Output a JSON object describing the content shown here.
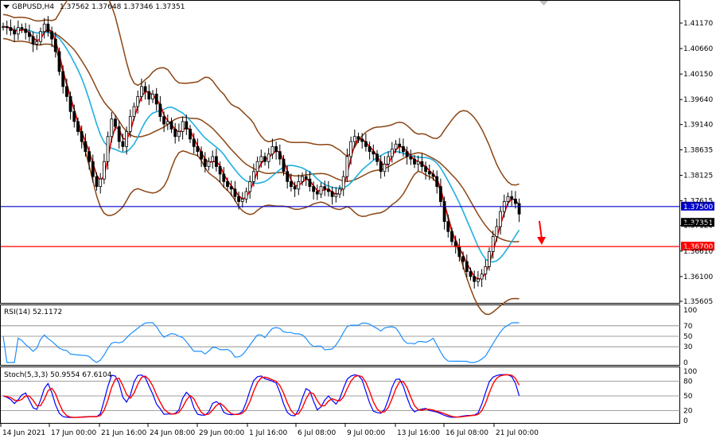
{
  "header": {
    "symbol_label": "GBPUSD,H4",
    "ohlc_label": "1.37562 1.37648 1.37346 1.37351"
  },
  "main_panel": {
    "price_ticks": [
      "1.41170",
      "1.40660",
      "1.40150",
      "1.39640",
      "1.39140",
      "1.38635",
      "1.38125",
      "1.37615",
      "1.37120",
      "1.36610",
      "1.36100",
      "1.35605"
    ],
    "tick_values": [
      1.4117,
      1.4066,
      1.4015,
      1.3964,
      1.3914,
      1.38635,
      1.38125,
      1.37615,
      1.3712,
      1.3661,
      1.361,
      1.35605
    ],
    "levels": [
      {
        "value": 1.375,
        "label": "1.37500",
        "color": "#0000cc"
      },
      {
        "value": 1.367,
        "label": "1.36700",
        "color": "#ff0000"
      }
    ],
    "current_price": {
      "value": 1.37351,
      "label": "1.37351",
      "color": "#000000"
    }
  },
  "rsi_panel": {
    "label": "RSI(14) 52.1172",
    "ticks": [
      "100",
      "70",
      "50",
      "30",
      "0"
    ],
    "tick_values": [
      100,
      70,
      50,
      30,
      0
    ],
    "levels": [
      70,
      50,
      30
    ],
    "color": "#1e90ff"
  },
  "stoch_panel": {
    "label": "Stoch(5,3,3) 50.9554 67.6104",
    "ticks": [
      "100",
      "80",
      "50",
      "20",
      "0"
    ],
    "tick_values": [
      100,
      80,
      50,
      20,
      0
    ],
    "levels": [
      80,
      50,
      20
    ],
    "main_color": "#0000ff",
    "signal_color": "#ff0000"
  },
  "time_axis": {
    "labels": [
      "14 Jun 2021",
      "17 Jun 00:00",
      "21 Jun 16:00",
      "24 Jun 08:00",
      "29 Jun 00:00",
      "1 Jul 16:00",
      "6 Jul 08:00",
      "9 Jul 00:00",
      "13 Jul 16:00",
      "16 Jul 08:00",
      "21 Jul 00:00"
    ],
    "label_bars": [
      0,
      14,
      28,
      42,
      56,
      70,
      84,
      98,
      112,
      126,
      140
    ]
  },
  "chart_data": {
    "type": "candlestick",
    "symbol": "GBPUSD",
    "timeframe": "H4",
    "ohlc_last": {
      "open": 1.37562,
      "high": 1.37648,
      "low": 1.37346,
      "close": 1.37351
    },
    "ylim": [
      1.3552,
      1.415
    ],
    "close_series": [
      1.411,
      1.4108,
      1.4102,
      1.4095,
      1.4108,
      1.4105,
      1.4098,
      1.409,
      1.4075,
      1.408,
      1.41,
      1.4115,
      1.41,
      1.4085,
      1.406,
      1.402,
      1.399,
      1.397,
      1.394,
      1.392,
      1.39,
      1.388,
      1.386,
      1.384,
      1.381,
      1.379,
      1.3805,
      1.384,
      1.389,
      1.3925,
      1.391,
      1.388,
      1.387,
      1.39,
      1.393,
      1.395,
      1.397,
      1.399,
      1.398,
      1.3965,
      1.3975,
      1.3955,
      1.393,
      1.3915,
      1.392,
      1.3905,
      1.389,
      1.39,
      1.392,
      1.3905,
      1.3885,
      1.387,
      1.386,
      1.3845,
      1.383,
      1.384,
      1.385,
      1.383,
      1.3815,
      1.38,
      1.379,
      1.3785,
      1.377,
      1.376,
      1.3765,
      1.378,
      1.38,
      1.382,
      1.384,
      1.385,
      1.384,
      1.3855,
      1.387,
      1.386,
      1.3845,
      1.382,
      1.38,
      1.379,
      1.3785,
      1.38,
      1.381,
      1.3805,
      1.379,
      1.378,
      1.3775,
      1.379,
      1.3785,
      1.378,
      1.377,
      1.3775,
      1.3785,
      1.381,
      1.385,
      1.388,
      1.389,
      1.3885,
      1.388,
      1.387,
      1.386,
      1.3855,
      1.384,
      1.382,
      1.3835,
      1.385,
      1.3865,
      1.3875,
      1.387,
      1.386,
      1.385,
      1.3845,
      1.3835,
      1.384,
      1.383,
      1.382,
      1.3815,
      1.381,
      1.379,
      1.376,
      1.372,
      1.37,
      1.368,
      1.367,
      1.365,
      1.364,
      1.362,
      1.361,
      1.36,
      1.3605,
      1.3615,
      1.363,
      1.366,
      1.369,
      1.371,
      1.374,
      1.376,
      1.377,
      1.3765,
      1.3756,
      1.3735
    ]
  }
}
